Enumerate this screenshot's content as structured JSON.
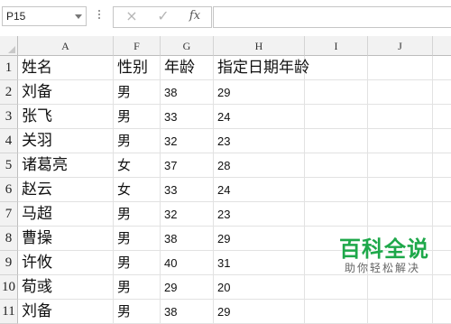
{
  "formula_bar": {
    "name_box": "P15",
    "cancel_icon": "×",
    "enter_icon": "✓",
    "fx_label": "fx",
    "formula": ""
  },
  "columns": [
    "A",
    "F",
    "G",
    "H",
    "I",
    "J"
  ],
  "rows": [
    {
      "num": "1",
      "cells": [
        "姓名",
        "性别",
        "年龄",
        "指定日期年龄"
      ]
    },
    {
      "num": "2",
      "cells": [
        "刘备",
        "男",
        "38",
        "29"
      ]
    },
    {
      "num": "3",
      "cells": [
        "张飞",
        "男",
        "33",
        "24"
      ]
    },
    {
      "num": "4",
      "cells": [
        "关羽",
        "男",
        "32",
        "23"
      ]
    },
    {
      "num": "5",
      "cells": [
        "诸葛亮",
        "女",
        "37",
        "28"
      ]
    },
    {
      "num": "6",
      "cells": [
        "赵云",
        "女",
        "33",
        "24"
      ]
    },
    {
      "num": "7",
      "cells": [
        "马超",
        "男",
        "32",
        "23"
      ]
    },
    {
      "num": "8",
      "cells": [
        "曹操",
        "男",
        "38",
        "29"
      ]
    },
    {
      "num": "9",
      "cells": [
        "许攸",
        "男",
        "40",
        "31"
      ]
    },
    {
      "num": "10",
      "cells": [
        "荀彧",
        "男",
        "29",
        "20"
      ]
    },
    {
      "num": "11",
      "cells": [
        "刘备",
        "男",
        "38",
        "29"
      ]
    }
  ],
  "watermark": {
    "title": "百科全说",
    "subtitle": "助你轻松解决"
  }
}
